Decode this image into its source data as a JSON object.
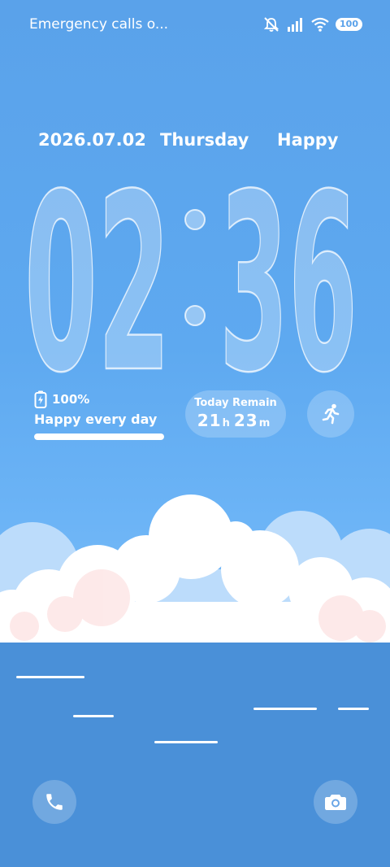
{
  "status_bar": {
    "carrier_text": "Emergency calls o...",
    "icons": [
      "mute-icon",
      "signal-icon",
      "wifi-icon"
    ],
    "battery_level": "100"
  },
  "lockscreen": {
    "date": "2026.07.02",
    "weekday": "Thursday",
    "mood": "Happy",
    "time": {
      "hours": "02",
      "minutes": "36"
    }
  },
  "battery_widget": {
    "percent_text": "100%",
    "motto": "Happy every day",
    "level": 1.0
  },
  "remain_widget": {
    "title": "Today Remain",
    "hours": "21",
    "hours_unit": "h",
    "minutes": "23",
    "minutes_unit": "m"
  },
  "shortcuts": {
    "run_icon": "running-person-icon",
    "phone_icon": "phone-icon",
    "camera_icon": "camera-icon"
  },
  "colors": {
    "sky": "#5aa2ea",
    "sea": "#4a90d8",
    "cloud": "#ffffff",
    "cloud_back": "#bcdcfb",
    "cloud_pink": "#fde6e6"
  }
}
